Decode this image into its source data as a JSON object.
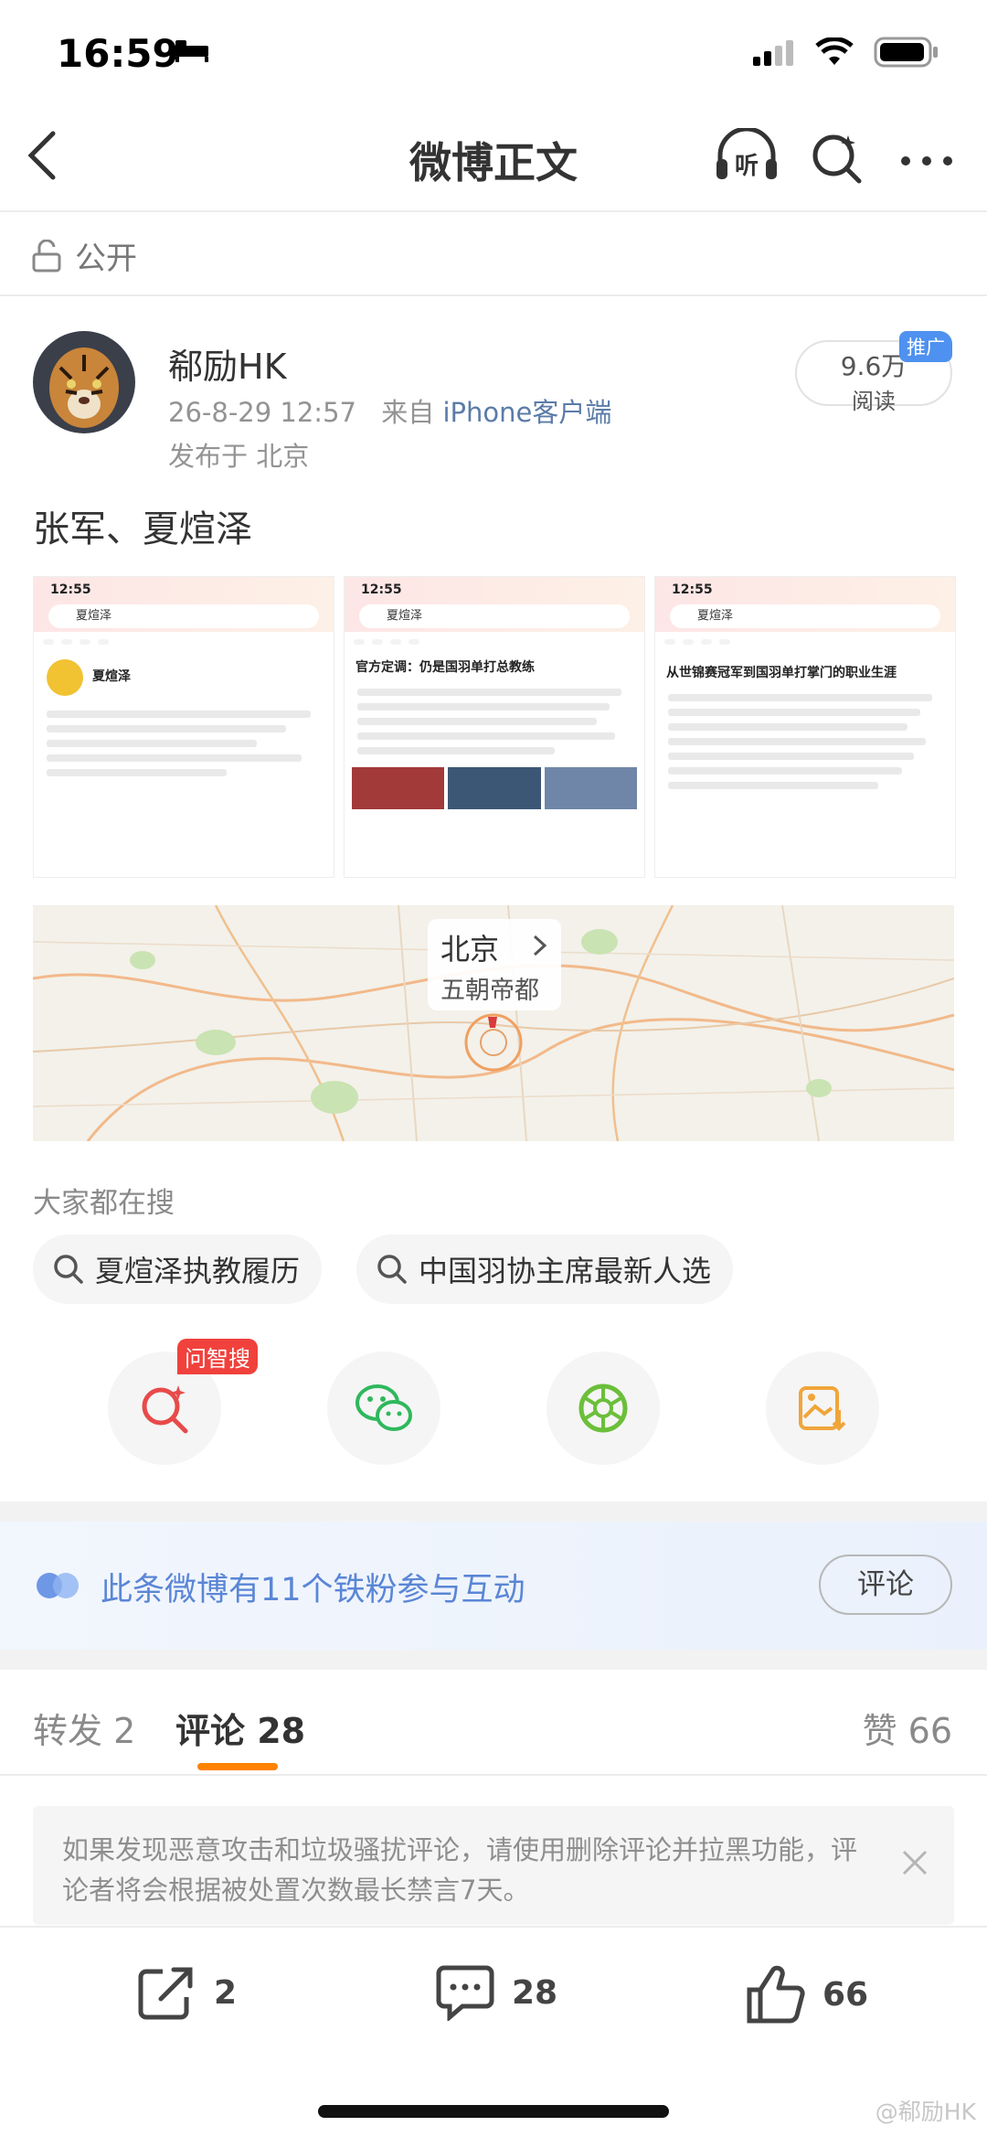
{
  "status_bar": {
    "time": "16:59"
  },
  "nav": {
    "title": "微博正文",
    "listen_label": "听"
  },
  "visibility": {
    "label": "公开"
  },
  "author": {
    "name": "郗励HK",
    "datetime": "26-8-29 12:57",
    "source_prefix": "来自",
    "source": "iPhone客户端",
    "location": "发布于 北京",
    "reads_count": "9.6万",
    "reads_label": "阅读",
    "promo_badge": "推广"
  },
  "post": {
    "text": "张军、夏煊泽"
  },
  "thumbnails": [
    {
      "time": "12:55",
      "query": "夏煊泽",
      "heading": "夏煊泽"
    },
    {
      "time": "12:55",
      "query": "夏煊泽",
      "heading": "官方定调：仍是国羽单打总教练"
    },
    {
      "time": "12:55",
      "query": "夏煊泽",
      "heading": "从世锦赛冠军到国羽单打掌门的职业生涯"
    }
  ],
  "map": {
    "city": "北京",
    "subtitle": "五朝帝都"
  },
  "trending": {
    "title": "大家都在搜",
    "chips": [
      "夏煊泽执教履历",
      "中国羽协主席最新人选"
    ]
  },
  "share": {
    "ai_badge": "问智搜"
  },
  "fans": {
    "text": "此条微博有11个铁粉参与互动",
    "button": "评论"
  },
  "tabs": {
    "repost": "转发 2",
    "comments": "评论 28",
    "likes": "赞 66"
  },
  "notice": {
    "text": "如果发现恶意攻击和垃圾骚扰评论，请使用删除评论并拉黑功能，评论者将会根据被处置次数最长禁言7天。"
  },
  "bottom_bar": {
    "repost_count": "2",
    "comment_count": "28",
    "like_count": "66"
  },
  "watermark": "@郗励HK"
}
